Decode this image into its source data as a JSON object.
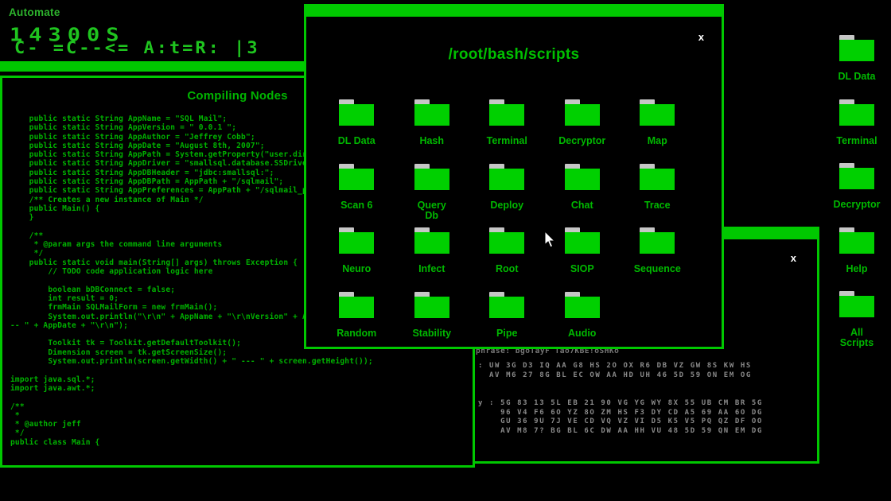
{
  "desktop": {
    "menu_label": "Automate",
    "clock_line1": "14300S",
    "clock_line2": "C-  =C--<=  A:t=R: |3",
    "sidebar_folders": [
      "DL Data",
      "Terminal",
      "Decryptor",
      "Help",
      "All\nScripts"
    ]
  },
  "code_window": {
    "title": "Compiling Nodes",
    "code_lines": [
      "    public static String AppName = \"SQL Mail\";",
      "    public static String AppVersion = \" 0.0.1 \";",
      "    public static String AppAuthor = \"Jeffrey Cobb\";",
      "    public static String AppDate = \"August 8th, 2007\";",
      "    public static String AppPath = System.getProperty(\"user.dir\");",
      "    public static String AppDriver = \"smallsql.database.SSDriver\";",
      "    public static String AppDBHeader = \"jdbc:smallsql:\";",
      "    public static String AppDBPath = AppPath + \"/sqlmail\";",
      "    public static String AppPreferences = AppPath + \"/sqlmail_prefs\"",
      "    /** Creates a new instance of Main */",
      "    public Main() {",
      "    }",
      "",
      "    /**",
      "     * @param args the command line arguments",
      "     */",
      "    public static void main(String[] args) throws Exception {",
      "        // TODO code application logic here",
      "",
      "        boolean bDBConnect = false;",
      "        int result = 0;",
      "        frmMain SQLMailForm = new frmMain();",
      "        System.out.println(\"\\r\\n\" + AppName + \"\\r\\nVersion\" + AppVer",
      "-- \" + AppDate + \"\\r\\n\");",
      "",
      "        Toolkit tk = Toolkit.getDefaultToolkit();",
      "        Dimension screen = tk.getScreenSize();",
      "        System.out.println(screen.getWidth() + \" --- \" + screen.getHeight());",
      "",
      "import java.sql.*;",
      "import java.awt.*;",
      "",
      "/**",
      " *",
      " * @author jeff",
      " */",
      "public class Main {"
    ]
  },
  "file_window": {
    "title": "/root/bash/scripts",
    "close_label": "x",
    "folders": [
      "DL Data",
      "Hash",
      "Terminal",
      "Decryptor",
      "Map",
      "Scan 6",
      "Query\nDb",
      "Deploy",
      "Chat",
      "Trace",
      "Neuro",
      "Infect",
      "Root",
      "SIOP",
      "Sequence",
      "Random",
      "Stability",
      "Pipe",
      "Audio"
    ]
  },
  "crypto_window": {
    "close_label": "x",
    "phrase": "phrase: bgoTayF Tao7KBE!oSHKo",
    "hex_block_1": [
      ": UW 3G D3 IQ AA G8 HS 2O OX R6 DB VZ GW 8S KW HS",
      "  AV M6 27 8G BL EC OW AA HD UH 46 5D 59 ON EM OG"
    ],
    "hex_block_2": [
      "y : 5G 83 13 5L EB 21 90 VG YG WY 8X 55 UB CM BR 5G",
      "    96 V4 F6 6O YZ 8O ZM HS F3 DY CD A5 69 AA 6O DG",
      "    GU 36 9U 7J VE CD VQ VZ VI D5 K5 V5 PQ QZ DF OO",
      "    AV M8 7? BG BL 6C DW AA HH VU 48 5D 59 QN EM DG"
    ]
  },
  "colors": {
    "green_bar": "#00c800",
    "folder_green": "#00d000",
    "text_green": "#00b400",
    "gray_text": "#8a8a8a"
  }
}
